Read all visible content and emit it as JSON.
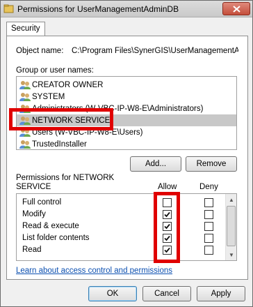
{
  "window": {
    "title": "Permissions for UserManagementAdminDB",
    "close_glyph": "✕"
  },
  "tabs": [
    {
      "label": "Security"
    }
  ],
  "object": {
    "label": "Object name:",
    "value": "C:\\Program Files\\SynerGIS\\UserManagementAdmi"
  },
  "groups": {
    "label": "Group or user names:",
    "items": [
      {
        "label": "CREATOR OWNER",
        "icon": "user-group-icon"
      },
      {
        "label": "SYSTEM",
        "icon": "user-group-icon"
      },
      {
        "label": "Administrators (W-VBC-IP-W8-E\\Administrators)",
        "icon": "user-group-icon"
      },
      {
        "label": "NETWORK SERVICE",
        "icon": "user-group-icon",
        "selected": true
      },
      {
        "label": "Users (W-VBC-IP-W8-E\\Users)",
        "icon": "user-group-icon"
      },
      {
        "label": "TrustedInstaller",
        "icon": "user-group-icon"
      }
    ]
  },
  "buttons": {
    "add": "Add...",
    "remove": "Remove",
    "ok": "OK",
    "cancel": "Cancel",
    "apply": "Apply"
  },
  "permissions": {
    "label_line1": "Permissions for NETWORK",
    "label_line2": "SERVICE",
    "allow_header": "Allow",
    "deny_header": "Deny",
    "rows": [
      {
        "label": "Full control",
        "allow": false,
        "deny": false
      },
      {
        "label": "Modify",
        "allow": true,
        "deny": false
      },
      {
        "label": "Read & execute",
        "allow": true,
        "deny": false
      },
      {
        "label": "List folder contents",
        "allow": true,
        "deny": false
      },
      {
        "label": "Read",
        "allow": true,
        "deny": false
      }
    ]
  },
  "link": "Learn about access control and permissions",
  "colors": {
    "highlight": "#e00000",
    "link": "#0b4fb0",
    "selected_row": "#c8c8c8"
  }
}
